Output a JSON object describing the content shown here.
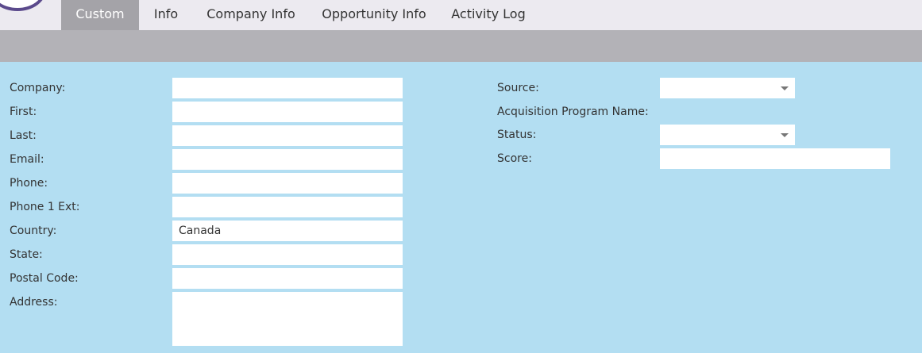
{
  "tabs": [
    {
      "label": "Custom",
      "active": true
    },
    {
      "label": "Info",
      "active": false
    },
    {
      "label": "Company Info",
      "active": false
    },
    {
      "label": "Opportunity Info",
      "active": false
    },
    {
      "label": "Activity Log",
      "active": false
    }
  ],
  "left_fields": {
    "company": {
      "label": "Company:",
      "value": ""
    },
    "first": {
      "label": "First:",
      "value": ""
    },
    "last": {
      "label": "Last:",
      "value": ""
    },
    "email": {
      "label": "Email:",
      "value": ""
    },
    "phone": {
      "label": "Phone:",
      "value": ""
    },
    "phone_ext": {
      "label": "Phone 1 Ext:",
      "value": ""
    },
    "country": {
      "label": "Country:",
      "value": "Canada"
    },
    "state": {
      "label": "State:",
      "value": ""
    },
    "postal_code": {
      "label": "Postal Code:",
      "value": ""
    },
    "address": {
      "label": "Address:",
      "value": ""
    }
  },
  "right_fields": {
    "source": {
      "label": "Source:",
      "value": ""
    },
    "acquisition_program": {
      "label": "Acquisition Program Name:",
      "value": ""
    },
    "status": {
      "label": "Status:",
      "value": ""
    },
    "score": {
      "label": "Score:",
      "value": ""
    }
  },
  "colors": {
    "content_bg": "#b3def2",
    "tabbar_bg": "#eceaf0",
    "active_tab_bg": "#a4a3a8",
    "band_bg": "#b3b2b7",
    "logo_ring": "#5b4a8c"
  }
}
